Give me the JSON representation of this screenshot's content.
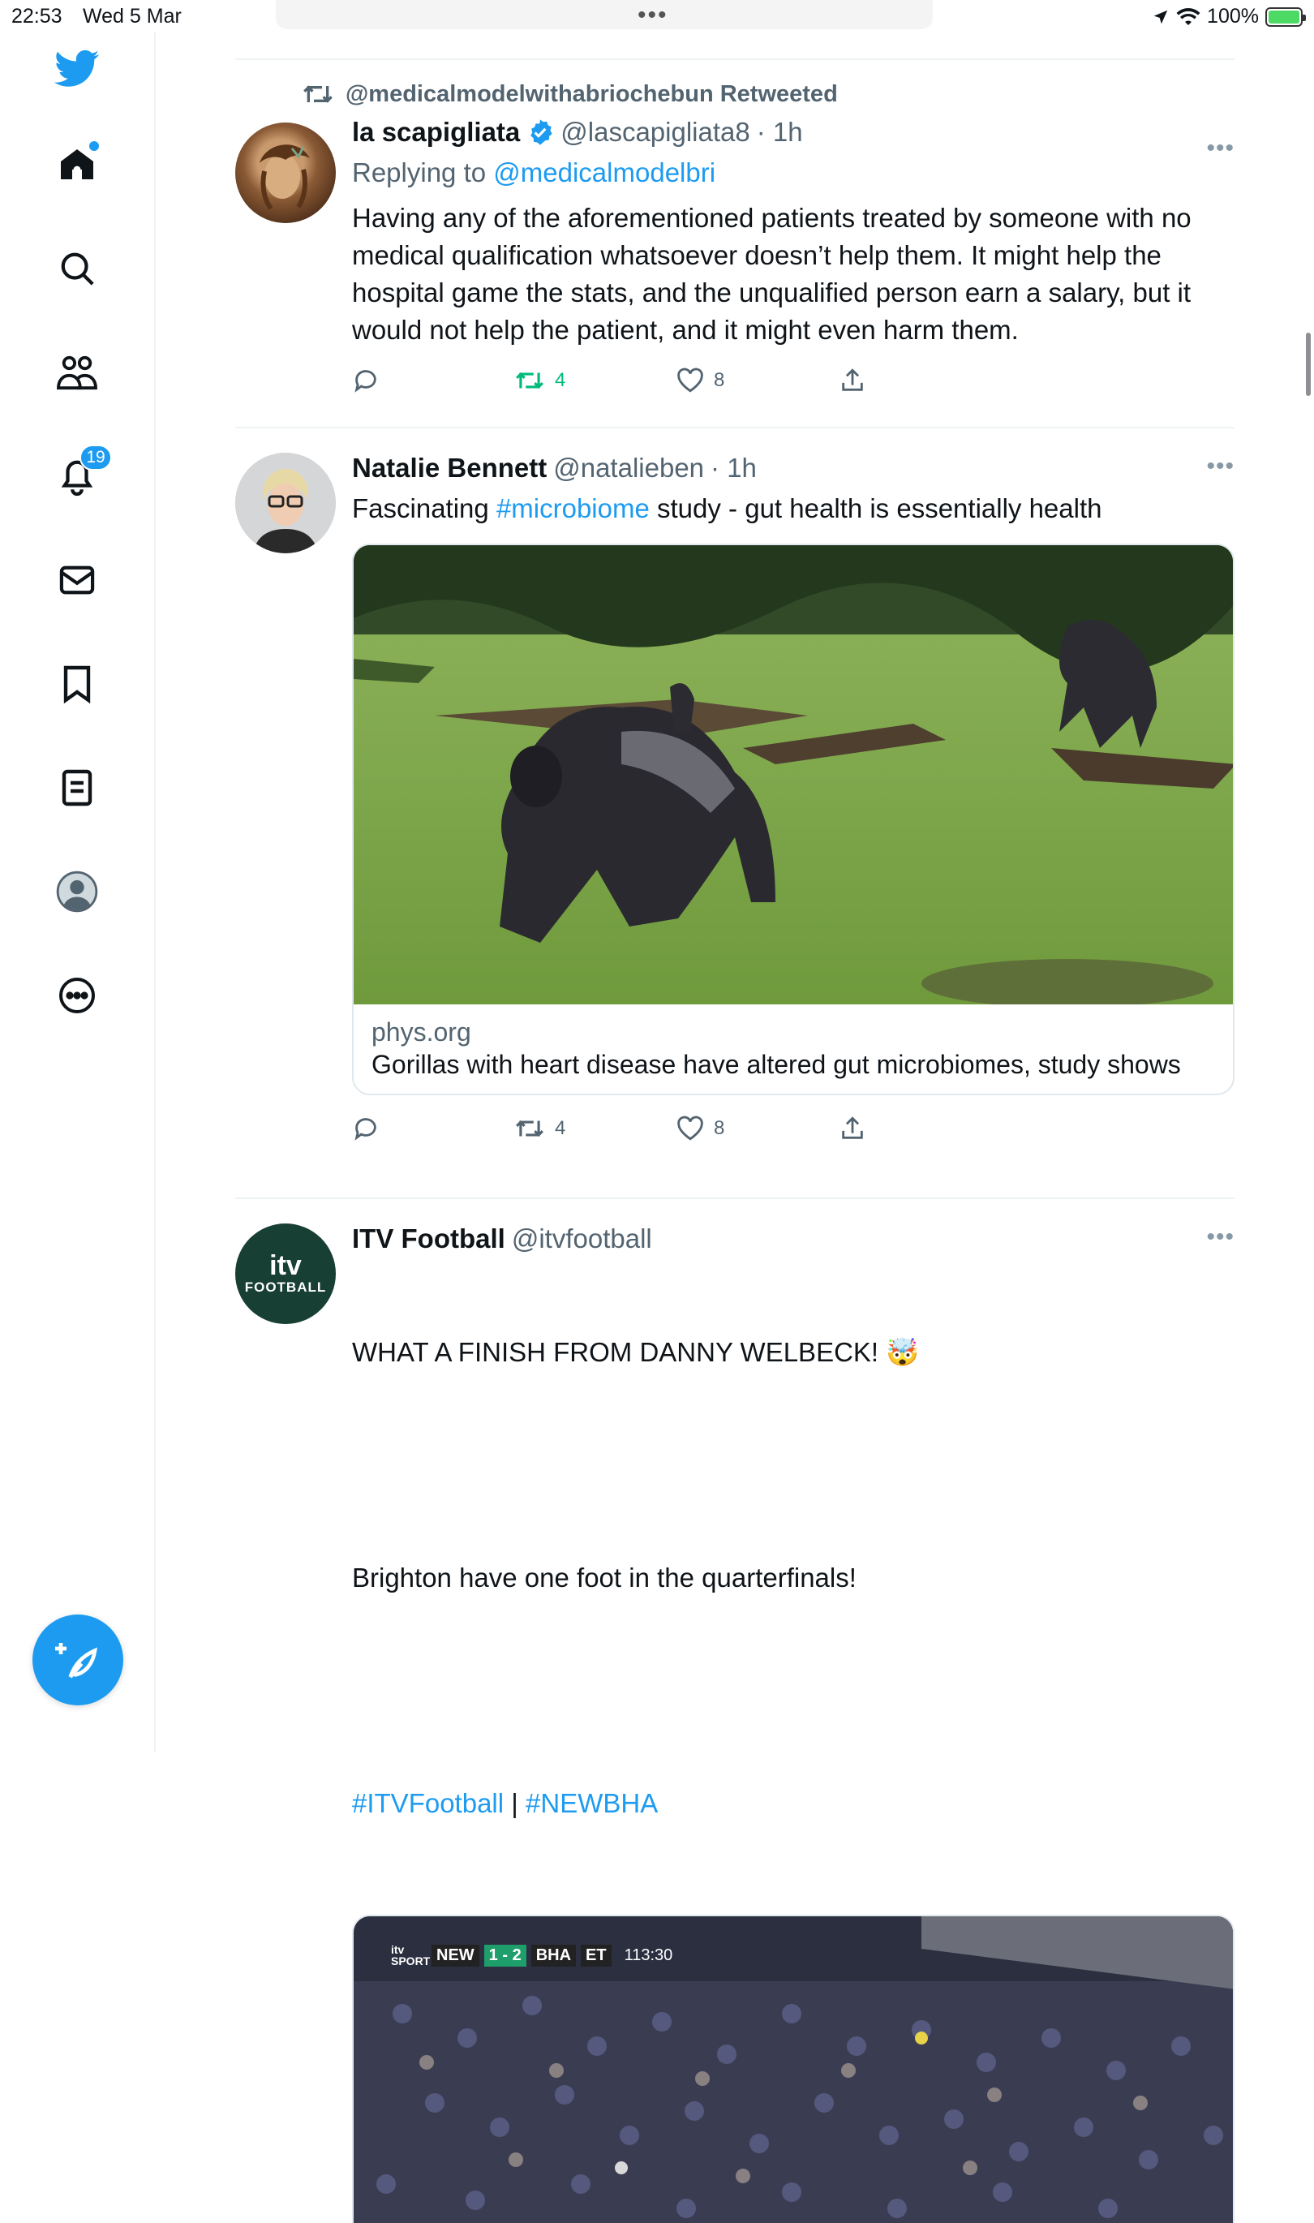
{
  "status_bar": {
    "time": "22:53",
    "date": "Wed 5 Mar",
    "battery": "100%"
  },
  "sidebar": {
    "notifications_badge": "19"
  },
  "colors": {
    "accent": "#1d9bf0",
    "retweet_green": "#00ba7c",
    "muted": "#536471"
  },
  "feed": {
    "tweets": [
      {
        "retweeted_by": "@medicalmodelwithabriochebun Retweeted",
        "name": "la scapigliata",
        "verified": true,
        "handle": "@lascapigliata8",
        "time": "· 1h",
        "replying_prefix": "Replying to",
        "replying_to": "@medicalmodelbri",
        "text": "Having any of the aforementioned patients treated by someone with no medical qualification whatsoever doesn’t help them. It might help the hospital game the stats, and the unqualified person earn a salary, but it would not help the patient, and it might even harm them.",
        "retweets": "4",
        "likes": "8"
      },
      {
        "name": "Natalie Bennett",
        "handle": "@natalieben",
        "time": "· 1h",
        "text_before": "Fascinating ",
        "hashtag": "#microbiome",
        "text_after": " study - gut health is essentially health",
        "card_source": "phys.org",
        "card_title": "Gorillas with heart disease have altered gut microbiomes, study shows",
        "retweets": "4",
        "likes": "8"
      },
      {
        "name": "ITV Football",
        "handle": "@itvfootball",
        "avatar_text_top": "itv",
        "avatar_text_bottom": "FOOTBALL",
        "line1": "WHAT A FINISH FROM DANNY WELBECK! 🤯",
        "line2": "Brighton have one foot in the quarterfinals!",
        "hashtag1": "#ITVFootball",
        "separator": " | ",
        "hashtag2": "#NEWBHA",
        "scoreboard": {
          "brand": "itv SPORT",
          "home": "NEW",
          "score": "1 - 2",
          "away": "BHA",
          "period": "ET",
          "clock": "113:30"
        }
      }
    ]
  }
}
